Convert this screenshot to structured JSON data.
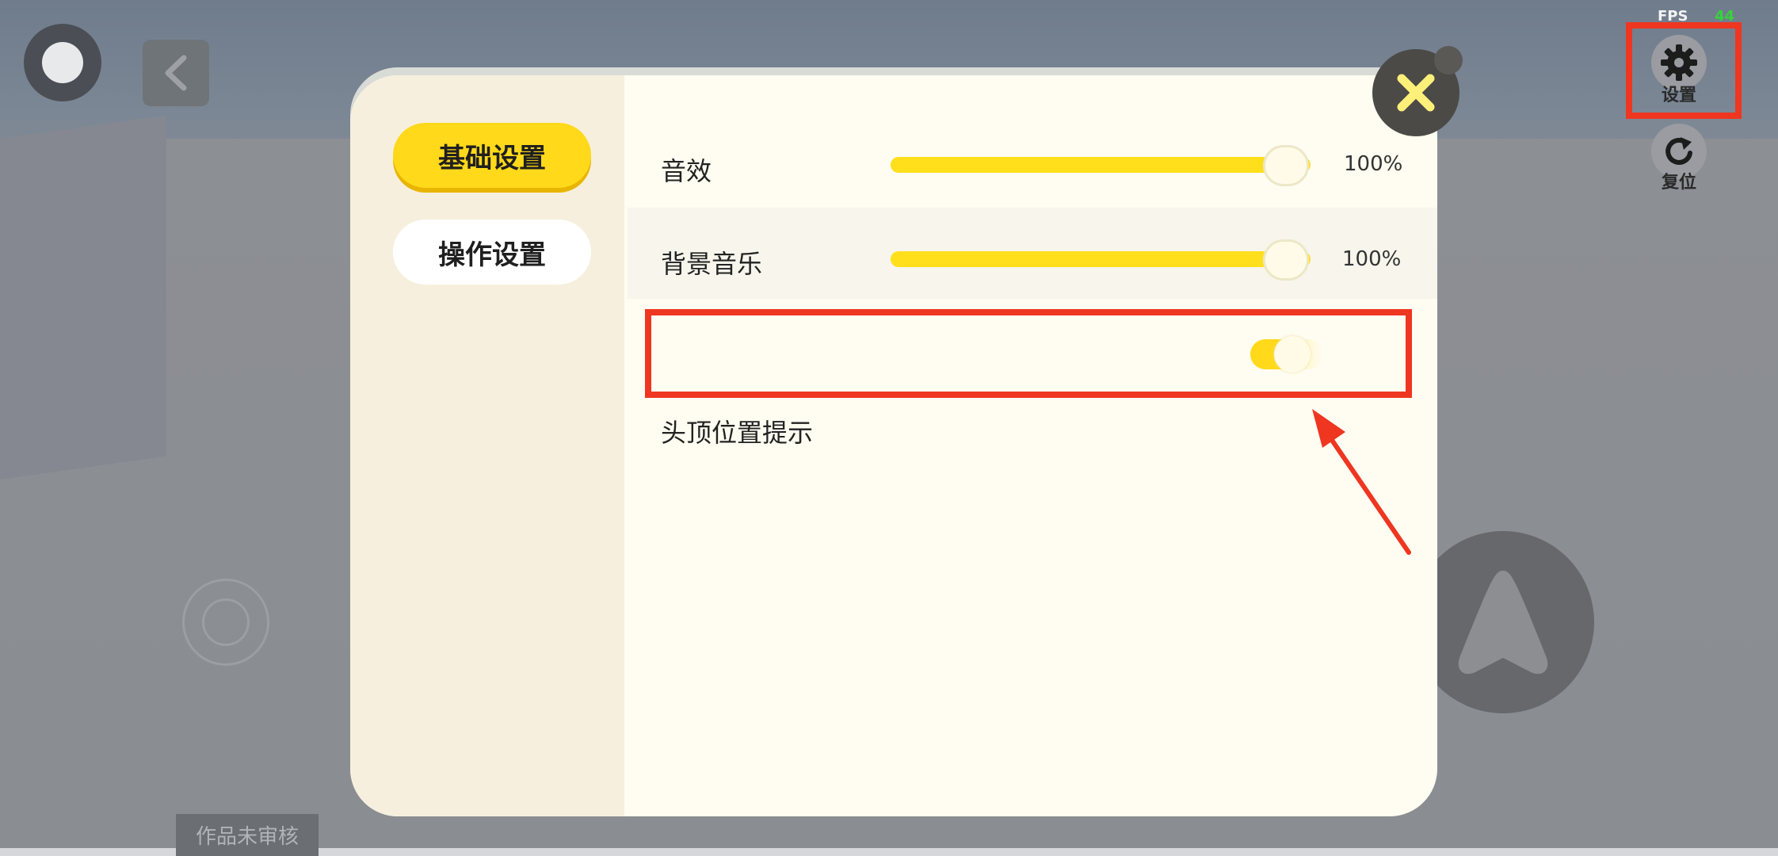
{
  "hud": {
    "fps_label": "FPS",
    "fps_value": "44",
    "settings_label": "设置",
    "reset_label": "复位"
  },
  "badge": {
    "text": "作品未审核"
  },
  "settings": {
    "tabs": [
      {
        "label": "基础设置",
        "active": true
      },
      {
        "label": "操作设置",
        "active": false
      }
    ],
    "sound_effects": {
      "label": "音效",
      "value": "100%",
      "level": 1.0
    },
    "music": {
      "label": "背景音乐",
      "value": "100%",
      "level": 1.0
    },
    "head_indicator": {
      "label": "头顶位置提示",
      "enabled": true
    }
  },
  "colors": {
    "accent": "#ffd91a",
    "highlight": "#ee3621",
    "fps_value": "#36d33b"
  },
  "icons": [
    "record-icon",
    "back-chevron-icon",
    "gear-icon",
    "reset-icon",
    "close-icon",
    "jump-icon",
    "joystick-icon"
  ]
}
